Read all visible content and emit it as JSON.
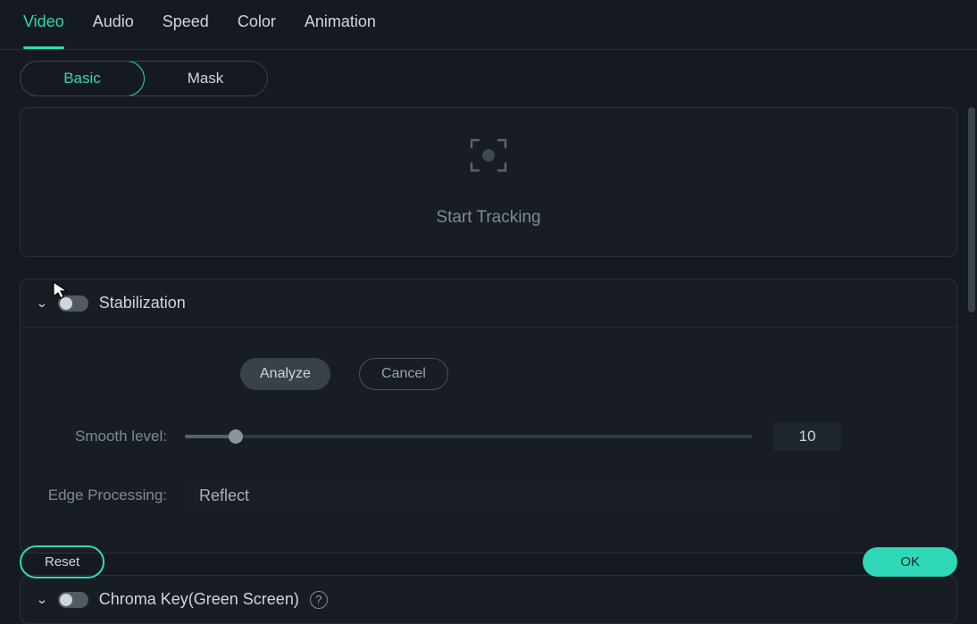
{
  "topTabs": {
    "video": "Video",
    "audio": "Audio",
    "speed": "Speed",
    "color": "Color",
    "animation": "Animation"
  },
  "subTabs": {
    "basic": "Basic",
    "mask": "Mask"
  },
  "tracking": {
    "label": "Start Tracking"
  },
  "stabilization": {
    "title": "Stabilization",
    "analyze": "Analyze",
    "cancel": "Cancel",
    "smooth_label": "Smooth level:",
    "smooth_value": "10",
    "edge_label": "Edge Processing:",
    "edge_value": "Reflect"
  },
  "chroma": {
    "title": "Chroma Key(Green Screen)"
  },
  "footer": {
    "reset": "Reset",
    "ok": "OK"
  }
}
